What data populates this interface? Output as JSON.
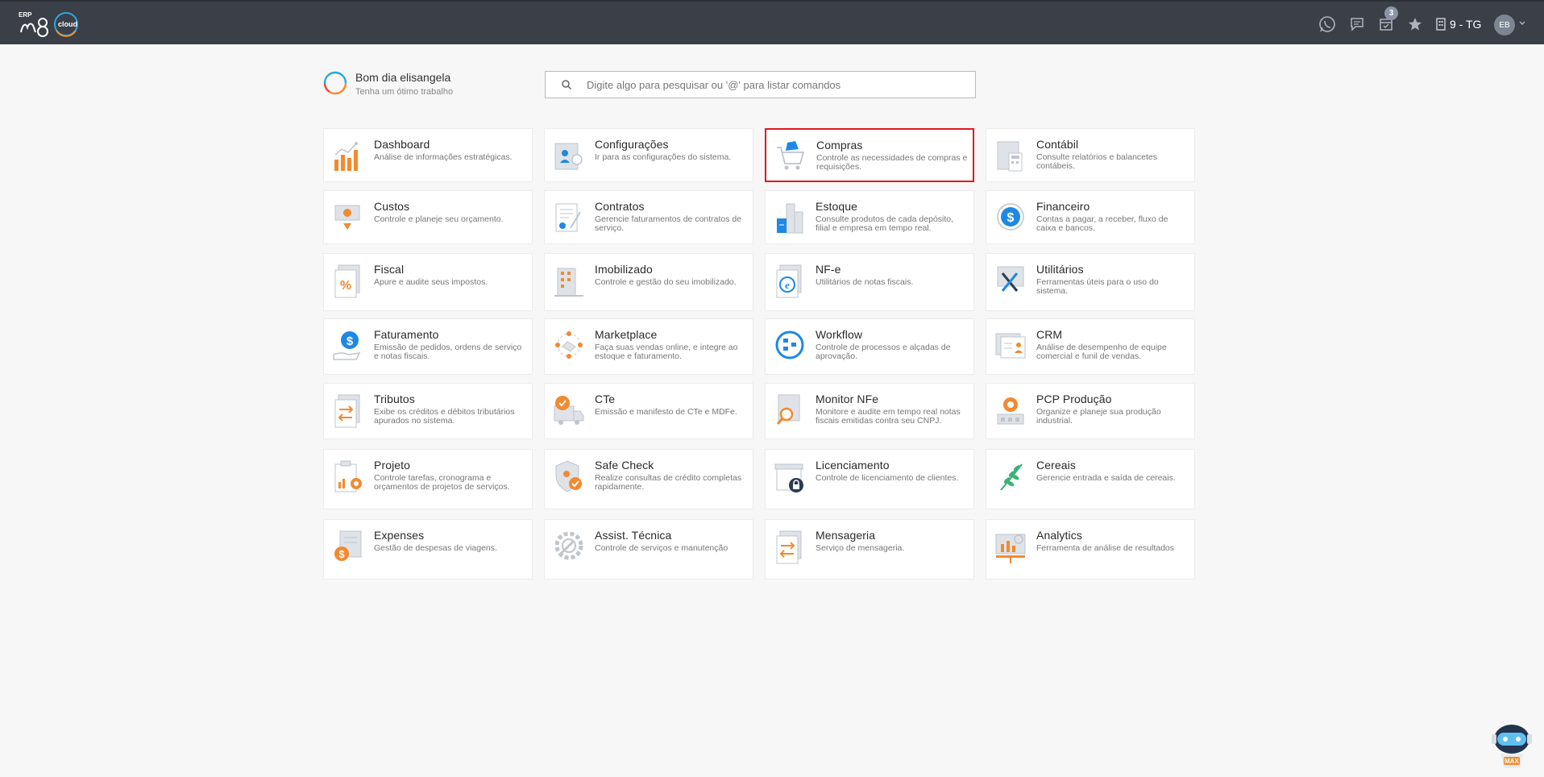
{
  "header": {
    "logo_erp": "ERP",
    "logo_brand": "m8",
    "logo_cloud": "cloud",
    "notifications_count": "3",
    "company_label": "9 - TG",
    "user_initials": "EB",
    "icons": [
      "whatsapp-icon",
      "chat-icon",
      "calendar-check-icon",
      "star-icon",
      "building-icon",
      "chevron-down-icon"
    ]
  },
  "greeting": {
    "title": "Bom dia elisangela",
    "subtitle": "Tenha um ótimo trabalho"
  },
  "search": {
    "placeholder": "Digite algo para pesquisar ou '@' para listar comandos",
    "value": ""
  },
  "modules": [
    {
      "title": "Dashboard",
      "desc": "Análise de informações estratégicas.",
      "icon": "dashboard-chart-icon"
    },
    {
      "title": "Configurações",
      "desc": "Ir para as configurações do sistema.",
      "icon": "settings-profile-icon"
    },
    {
      "title": "Compras",
      "desc": "Controle as necessidades de compras e requisições.",
      "icon": "shopping-cart-icon",
      "selected": true
    },
    {
      "title": "Contábil",
      "desc": "Consulte relatórios e balancetes contábeis.",
      "icon": "accounting-calculator-icon"
    },
    {
      "title": "Custos",
      "desc": "Controle e planeje seu orçamento.",
      "icon": "costs-money-icon"
    },
    {
      "title": "Contratos",
      "desc": "Gerencie faturamentos de contratos de serviço.",
      "icon": "contract-document-icon"
    },
    {
      "title": "Estoque",
      "desc": "Consulte produtos de cada depósito, filial e empresa em tempo real.",
      "icon": "inventory-boxes-icon"
    },
    {
      "title": "Financeiro",
      "desc": "Contas a pagar, a receber, fluxo de caixa e bancos.",
      "icon": "finance-dollar-icon"
    },
    {
      "title": "Fiscal",
      "desc": "Apure e audite seus impostos.",
      "icon": "tax-percent-icon"
    },
    {
      "title": "Imobilizado",
      "desc": "Controle e gestão do seu imobilizado.",
      "icon": "building-asset-icon"
    },
    {
      "title": "NF-e",
      "desc": "Utilitários de notas fiscais.",
      "icon": "invoice-e-icon"
    },
    {
      "title": "Utilitários",
      "desc": "Ferramentas úteis para o uso do sistema.",
      "icon": "tools-wrench-icon"
    },
    {
      "title": "Faturamento",
      "desc": "Emissão de pedidos, ordens de serviço e notas fiscais.",
      "icon": "billing-hand-dollar-icon"
    },
    {
      "title": "Marketplace",
      "desc": "Faça suas vendas online, e integre ao estoque e faturamento.",
      "icon": "marketplace-handshake-icon"
    },
    {
      "title": "Workflow",
      "desc": "Controle de processos e alçadas de aprovação.",
      "icon": "workflow-cycle-icon"
    },
    {
      "title": "CRM",
      "desc": "Análise de desempenho de equipe comercial e funil de vendas.",
      "icon": "crm-contact-card-icon"
    },
    {
      "title": "Tributos",
      "desc": "Exibe os créditos e débitos tributários apurados no sistema.",
      "icon": "taxes-arrows-icon"
    },
    {
      "title": "CTe",
      "desc": "Emissão e manifesto de CTe e MDFe.",
      "icon": "truck-check-icon"
    },
    {
      "title": "Monitor NFe",
      "desc": "Monitore e audite em tempo real notas fiscais emitidas contra seu CNPJ.",
      "icon": "monitor-magnifier-icon"
    },
    {
      "title": "PCP Produção",
      "desc": "Organize e planeje sua produção industrial.",
      "icon": "production-gear-icon"
    },
    {
      "title": "Projeto",
      "desc": "Controle tarefas, cronograma e orçamentos de projetos de serviços.",
      "icon": "project-clipboard-icon"
    },
    {
      "title": "Safe Check",
      "desc": "Realize consultas de crédito completas rapidamente.",
      "icon": "shield-check-icon"
    },
    {
      "title": "Licenciamento",
      "desc": "Controle de licenciamento de clientes.",
      "icon": "license-lock-icon"
    },
    {
      "title": "Cereais",
      "desc": "Gerencie entrada e saída de cereais.",
      "icon": "grain-leaf-icon"
    },
    {
      "title": "Expenses",
      "desc": "Gestão de despesas de viagens.",
      "icon": "expenses-coin-icon"
    },
    {
      "title": "Assist. Técnica",
      "desc": "Controle de serviços e manutenção",
      "icon": "tech-support-gear-icon"
    },
    {
      "title": "Mensageria",
      "desc": "Serviço de mensageria.",
      "icon": "messaging-arrows-icon"
    },
    {
      "title": "Analytics",
      "desc": "Ferramenta de análise de resultados",
      "icon": "analytics-screen-icon"
    }
  ],
  "assistant": {
    "label": "MAX",
    "icon": "robot-assistant-icon"
  },
  "colors": {
    "topbar": "#3b3f47",
    "accent_orange": "#f28a30",
    "accent_blue": "#1e88e5",
    "selected_border": "#e0191e"
  }
}
